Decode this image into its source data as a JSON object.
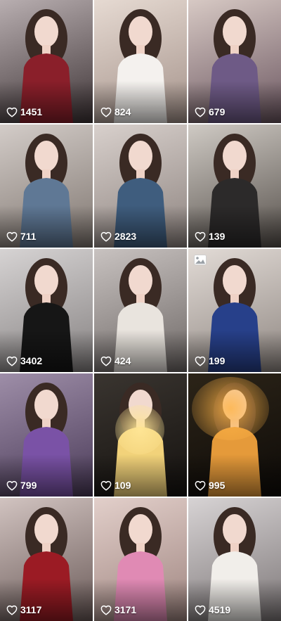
{
  "grid": {
    "items": [
      {
        "likes": "1451",
        "bg": [
          "#b8aeb0",
          "#3e3436"
        ],
        "outfit": "#8a1f2a"
      },
      {
        "likes": "824",
        "bg": [
          "#e6dad2",
          "#a4928a"
        ],
        "outfit": "#f4f1ee"
      },
      {
        "likes": "679",
        "bg": [
          "#d7c9c4",
          "#6b5660"
        ],
        "outfit": "#6e5a86"
      },
      {
        "likes": "711",
        "bg": [
          "#d3ccc8",
          "#7f7670"
        ],
        "outfit": "#5f7895"
      },
      {
        "likes": "2823",
        "bg": [
          "#d8d0cc",
          "#8d837f"
        ],
        "outfit": "#3f5d7e"
      },
      {
        "likes": "139",
        "bg": [
          "#cfcac4",
          "#56504b"
        ],
        "outfit": "#2c2a2a"
      },
      {
        "likes": "3402",
        "bg": [
          "#d6d3d3",
          "#858181"
        ],
        "outfit": "#161616"
      },
      {
        "likes": "424",
        "bg": [
          "#c8c2c0",
          "#6e6866"
        ],
        "outfit": "#e9e4de"
      },
      {
        "likes": "199",
        "bg": [
          "#e2dbd6",
          "#8f8782"
        ],
        "outfit": "#27408a",
        "image_badge": "image-icon"
      },
      {
        "likes": "799",
        "bg": [
          "#9e8ea8",
          "#4a3a58"
        ],
        "outfit": "#7a52a6"
      },
      {
        "likes": "109",
        "bg": [
          "#3a3530",
          "#15120f"
        ],
        "outfit": "#f2d27a"
      },
      {
        "likes": "995",
        "bg": [
          "#2c2418",
          "#0e0b08"
        ],
        "outfit": "#e59a3a"
      },
      {
        "likes": "3117",
        "bg": [
          "#d1c3c0",
          "#6a5a58"
        ],
        "outfit": "#9b1b24"
      },
      {
        "likes": "3171",
        "bg": [
          "#e2cfca",
          "#9f8580"
        ],
        "outfit": "#e08ab4"
      },
      {
        "likes": "4519",
        "bg": [
          "#d7d3d4",
          "#7d7778"
        ],
        "outfit": "#f1eeea"
      }
    ]
  }
}
